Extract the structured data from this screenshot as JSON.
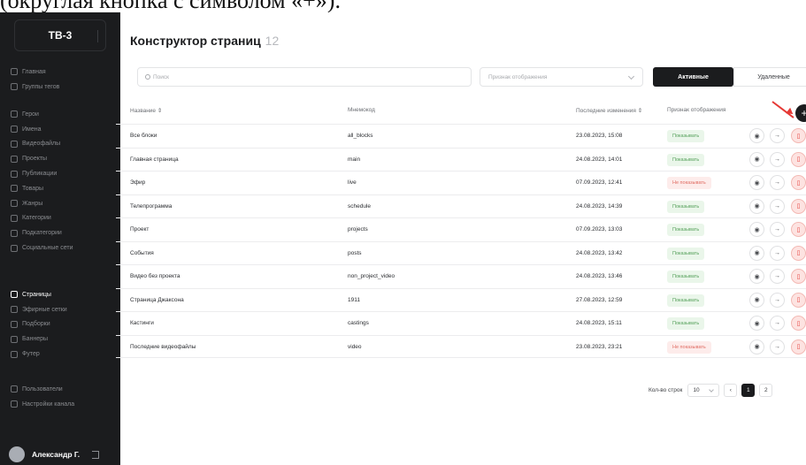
{
  "doc_fragment": "(округлая кнопка с символом «+»).",
  "sidebar": {
    "brand": "ТВ-3",
    "items_top": [
      {
        "label": "Главная",
        "icon": "home-icon"
      },
      {
        "label": "Группы тегов",
        "icon": "tag-group-icon"
      }
    ],
    "items_mid": [
      {
        "label": "Герои",
        "icon": "hero-icon"
      },
      {
        "label": "Имена",
        "icon": "star-icon"
      },
      {
        "label": "Видеофайлы",
        "icon": "video-icon"
      },
      {
        "label": "Проекты",
        "icon": "projects-icon"
      },
      {
        "label": "Публикации",
        "icon": "publications-icon"
      },
      {
        "label": "Товары",
        "icon": "bag-icon"
      },
      {
        "label": "Жанры",
        "icon": "genres-icon"
      },
      {
        "label": "Категории",
        "icon": "folder-icon"
      },
      {
        "label": "Подкатегории",
        "icon": "subfolder-icon"
      },
      {
        "label": "Социальные сети",
        "icon": "link-icon"
      }
    ],
    "items_pages": [
      {
        "label": "Страницы",
        "icon": "pages-icon",
        "active": true
      },
      {
        "label": "Эфирные сетки",
        "icon": "broadcast-icon"
      },
      {
        "label": "Подборки",
        "icon": "collections-icon"
      },
      {
        "label": "Баннеры",
        "icon": "banner-icon"
      },
      {
        "label": "Футер",
        "icon": "footer-icon"
      }
    ],
    "items_bottom": [
      {
        "label": "Пользователи",
        "icon": "user-icon"
      },
      {
        "label": "Настройки канала",
        "icon": "settings-icon"
      }
    ],
    "user_name": "Александр Г."
  },
  "header": {
    "title": "Конструктор страниц",
    "count": "12"
  },
  "filters": {
    "search_placeholder": "Поиск",
    "display_placeholder": "Признак отображения",
    "tab_active": "Активные",
    "tab_deleted": "Удаленные"
  },
  "table": {
    "columns": {
      "name": "Название",
      "mnemonic": "Мнемокод",
      "modified": "Последние изменения",
      "display": "Признак отображения"
    },
    "rows": [
      {
        "name": "Все блоки",
        "code": "all_blocks",
        "date": "23.08.2023, 15:08",
        "status": "Показывать",
        "kind": "show"
      },
      {
        "name": "Главная страница",
        "code": "main",
        "date": "24.08.2023, 14:01",
        "status": "Показывать",
        "kind": "show"
      },
      {
        "name": "Эфир",
        "code": "live",
        "date": "07.09.2023, 12:41",
        "status": "Не показывать",
        "kind": "hide"
      },
      {
        "name": "Телепрограмма",
        "code": "schedule",
        "date": "24.08.2023, 14:39",
        "status": "Показывать",
        "kind": "show"
      },
      {
        "name": "Проект",
        "code": "projects",
        "date": "07.09.2023, 13:03",
        "status": "Показывать",
        "kind": "show"
      },
      {
        "name": "События",
        "code": "posts",
        "date": "24.08.2023, 13:42",
        "status": "Показывать",
        "kind": "show"
      },
      {
        "name": "Видео без проекта",
        "code": "non_project_video",
        "date": "24.08.2023, 13:46",
        "status": "Показывать",
        "kind": "show"
      },
      {
        "name": "Страница Джаксона",
        "code": "1911",
        "date": "27.08.2023, 12:59",
        "status": "Показывать",
        "kind": "show"
      },
      {
        "name": "Кастинги",
        "code": "castings",
        "date": "24.08.2023, 15:11",
        "status": "Показывать",
        "kind": "show"
      },
      {
        "name": "Последние видеофайлы",
        "code": "video",
        "date": "23.08.2023, 23:21",
        "status": "Не показывать",
        "kind": "hide"
      }
    ]
  },
  "pagination": {
    "rows_label": "Кол-во строк",
    "rows_value": "10",
    "pages": [
      "1",
      "2"
    ],
    "current": "1"
  },
  "colors": {
    "sidebar_bg": "#1b1c1e",
    "accent_red": "#e53935",
    "show_green": "#55a05a",
    "hide_red": "#e06c63"
  }
}
